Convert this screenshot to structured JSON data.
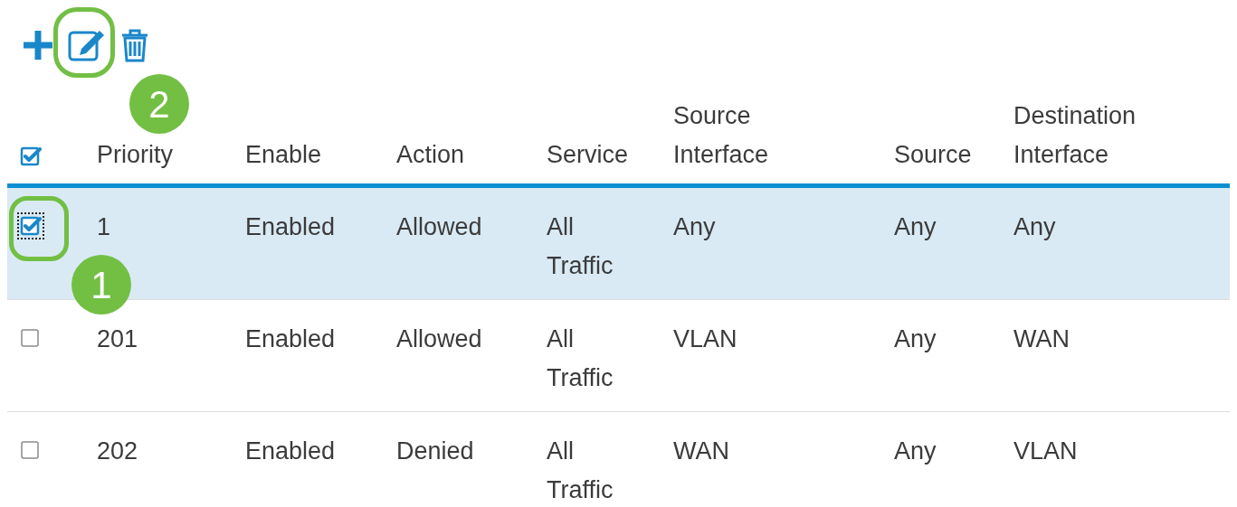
{
  "toolbar": {
    "edit_highlighted": true,
    "step_badge": "2"
  },
  "table": {
    "select_all_checked": true,
    "columns": [
      "Priority",
      "Enable",
      "Action",
      "Service",
      "Source Interface",
      "Source",
      "Destination Interface"
    ],
    "rows": [
      {
        "selected": true,
        "checked": true,
        "focused": true,
        "highlighted": true,
        "step_badge": "1",
        "cells": [
          "1",
          "Enabled",
          "Allowed",
          "All Traffic",
          "Any",
          "Any",
          "Any"
        ]
      },
      {
        "selected": false,
        "checked": false,
        "focused": false,
        "highlighted": false,
        "cells": [
          "201",
          "Enabled",
          "Allowed",
          "All Traffic",
          "VLAN",
          "Any",
          "WAN"
        ]
      },
      {
        "selected": false,
        "checked": false,
        "focused": false,
        "highlighted": false,
        "cells": [
          "202",
          "Enabled",
          "Denied",
          "All Traffic",
          "WAN",
          "Any",
          "VLAN"
        ]
      }
    ]
  }
}
